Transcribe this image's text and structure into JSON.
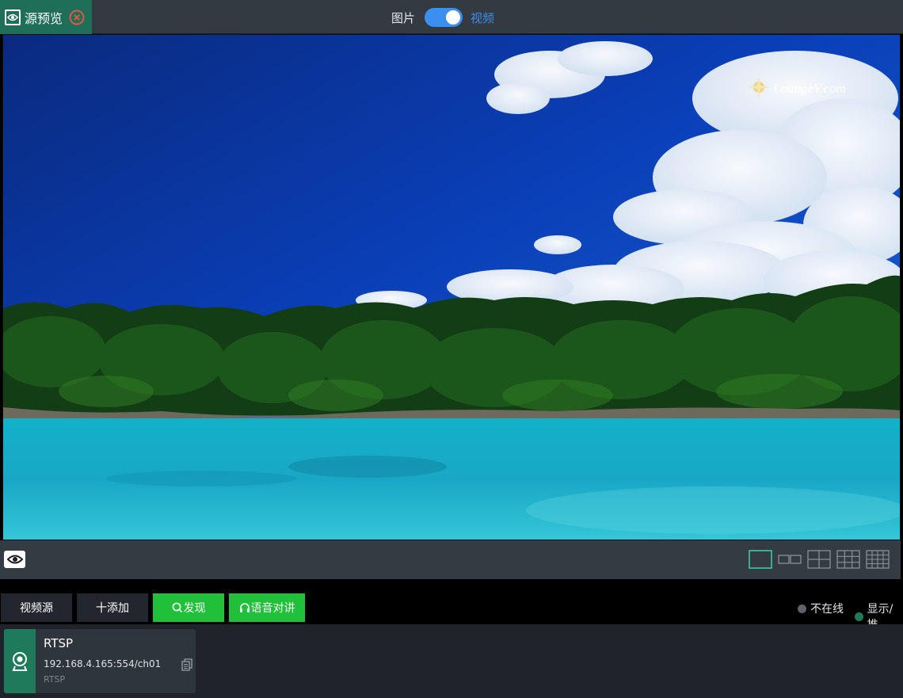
{
  "tab": {
    "label": "源预览",
    "icon": "eye-icon",
    "close_icon": "close-circle-icon"
  },
  "mode": {
    "left": "图片",
    "right": "视频",
    "selected": "视频"
  },
  "preview": {
    "watermark": "LoungeV.com"
  },
  "controls": {
    "layouts": [
      "1",
      "2",
      "4",
      "9",
      "16"
    ],
    "active_layout": "1"
  },
  "toolbar": {
    "video_source": "视频源",
    "add": "十添加",
    "discover": "发现",
    "talk": "语音对讲"
  },
  "legend": {
    "offline": "不在线",
    "display": "显示/推",
    "offline_color": "#5e6369",
    "display_color": "#1e7b58"
  },
  "sources": [
    {
      "name": "RTSP",
      "address": "192.168.4.165:554/ch01",
      "protocol": "RTSP"
    }
  ],
  "colors": {
    "accent_green": "#20c03a",
    "toggle_blue": "#3b8ff0",
    "tab_green": "#1f6e58"
  }
}
